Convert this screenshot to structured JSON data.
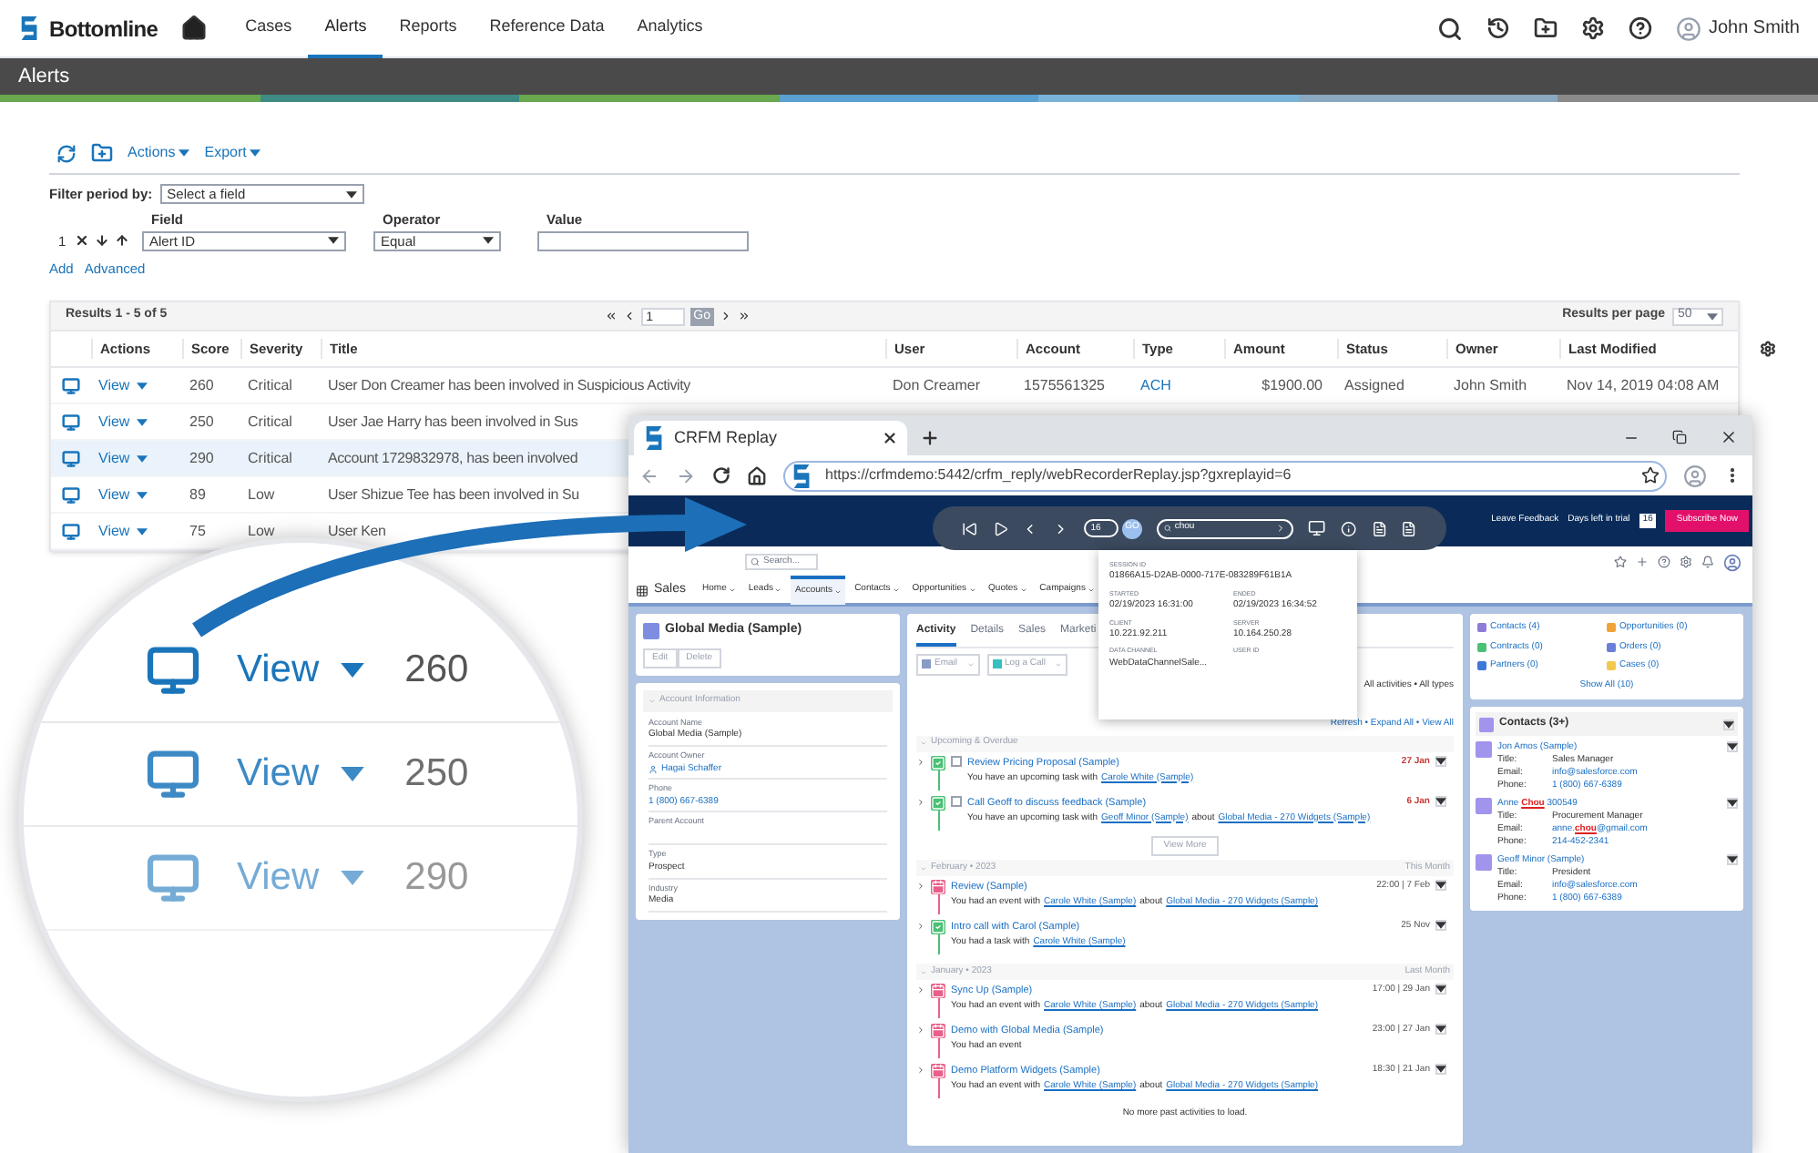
{
  "app_bar": {
    "logo": "Bottomline",
    "nav": [
      {
        "label": "Cases",
        "selected": false
      },
      {
        "label": "Alerts",
        "selected": true
      },
      {
        "label": "Reports",
        "selected": false
      },
      {
        "label": "Reference Data",
        "selected": false
      },
      {
        "label": "Analytics",
        "selected": false
      }
    ],
    "user": "John Smith"
  },
  "page_title": "Alerts",
  "toolbar": {
    "menus": [
      "Actions",
      "Export"
    ]
  },
  "filter": {
    "period_label": "Filter period by:",
    "period_placeholder": "Select a field",
    "row_number": "1",
    "field_label": "Field",
    "field_value": "Alert ID",
    "operator_label": "Operator",
    "operator_value": "Equal",
    "value_label": "Value",
    "links": [
      "Add",
      "Advanced"
    ]
  },
  "results": {
    "summary": "Results 1 - 5 of 5",
    "page": "1",
    "go": "Go",
    "per_page_label": "Results per page",
    "per_page": "50",
    "columns": [
      "Actions",
      "Score",
      "Severity",
      "Title",
      "User",
      "Account",
      "Type",
      "Amount",
      "Status",
      "Owner",
      "Last Modified"
    ],
    "rows": [
      {
        "selected": false,
        "cells": [
          "View",
          "260",
          "Critical",
          "User Don Creamer has been involved in Suspicious Activity",
          "Don Creamer",
          "1575561325",
          "ACH",
          "$1900.00",
          "Assigned",
          "John Smith",
          "Nov 14, 2019 04:08 AM"
        ]
      },
      {
        "selected": false,
        "cells": [
          "View",
          "250",
          "Critical",
          "User Jae Harry has been involved in Sus"
        ]
      },
      {
        "selected": true,
        "cells": [
          "View",
          "290",
          "Critical",
          "Account 1729832978, has been involved"
        ]
      },
      {
        "selected": false,
        "cells": [
          "View",
          "89",
          "Low",
          "User Shizue Tee has been involved in Su"
        ]
      },
      {
        "selected": false,
        "cells": [
          "View",
          "75",
          "Low",
          "User Ken"
        ]
      }
    ]
  },
  "lens": {
    "rows": [
      {
        "action": "View",
        "score": "260"
      },
      {
        "action": "View",
        "score": "250"
      },
      {
        "action": "View",
        "score": "290"
      }
    ]
  },
  "browser": {
    "tab_title": "CRFM Replay",
    "url": "https://crfmdemo:5442/crfm_reply/webRecorderReplay.jsp?gxreplayid=6"
  },
  "replay": {
    "step": "16",
    "go": "GO",
    "search": "chou",
    "header_links": [
      "Leave Feedback",
      "Days left in trial"
    ],
    "trial_days": "16",
    "subscribe": "Subscribe Now",
    "session": [
      {
        "label": "SESSION ID",
        "value": "01866A15-D2AB-0000-717E-083289F61B1A"
      },
      {
        "label": "STARTED",
        "value": "02/19/2023 16:31:00"
      },
      {
        "label": "ENDED",
        "value": "02/19/2023 16:34:52"
      },
      {
        "label": "CLIENT",
        "value": "10.221.92.211"
      },
      {
        "label": "SERVER",
        "value": "10.164.250.28"
      },
      {
        "label": "DATA CHANNEL",
        "value": "WebDataChannelSale..."
      },
      {
        "label": "USER ID"
      }
    ]
  },
  "crm": {
    "search_placeholder": "Search...",
    "app": "Sales",
    "nav": [
      {
        "label": "Home",
        "selected": false
      },
      {
        "label": "Leads",
        "selected": false
      },
      {
        "label": "Accounts",
        "selected": true
      },
      {
        "label": "Contacts",
        "selected": false
      },
      {
        "label": "Opportunities",
        "selected": false
      },
      {
        "label": "Quotes",
        "selected": false
      },
      {
        "label": "Campaigns",
        "selected": false
      }
    ],
    "record": {
      "title": "Global Media (Sample)",
      "buttons": [
        "Edit",
        "Delete"
      ],
      "section": "Account Information",
      "fields": [
        {
          "label": "Account Name",
          "value": "Global Media (Sample)",
          "kind": "text"
        },
        {
          "label": "Account Owner",
          "value": "Hagai Schaffer",
          "kind": "user"
        },
        {
          "label": "Phone",
          "value": "1 (800) 667-6389",
          "kind": "link"
        },
        {
          "label": "Parent Account"
        },
        {
          "label": "Type",
          "value": "Prospect",
          "kind": "text"
        },
        {
          "label": "Industry",
          "value": "Media",
          "kind": "text"
        }
      ]
    },
    "activity": {
      "tabs": [
        {
          "label": "Activity",
          "selected": true
        },
        {
          "label": "Details",
          "selected": false
        },
        {
          "label": "Sales",
          "selected": false
        },
        {
          "label": "Marketi",
          "selected": false
        }
      ],
      "actions": [
        "Email",
        "Log a Call"
      ],
      "filter": "All activities • All types",
      "links": "Refresh • Expand All • View All",
      "groups": [
        {
          "title": "Upcoming & Overdue",
          "more": "View More",
          "items": [
            {
              "kind": "task",
              "checked": false,
              "title": "Review Pricing Proposal (Sample)",
              "parts": [
                {
                  "text": "You have an upcoming task with"
                },
                {
                  "text": "Carole White (Sample)",
                  "link": true
                }
              ],
              "date": "27 Jan",
              "overdue": true
            },
            {
              "kind": "task",
              "checked": false,
              "title": "Call Geoff to discuss feedback (Sample)",
              "parts": [
                {
                  "text": "You have an upcoming task with"
                },
                {
                  "text": "Geoff Minor (Sample)",
                  "link": true
                },
                {
                  "text": "about"
                },
                {
                  "text": "Global Media - 270 Widgets (Sample)",
                  "link": true
                }
              ],
              "date": "6 Jan",
              "overdue": true
            }
          ]
        },
        {
          "title": "February • 2023",
          "period": "This Month",
          "items": [
            {
              "kind": "event",
              "title": "Review (Sample)",
              "parts": [
                {
                  "text": "You had an event with"
                },
                {
                  "text": "Carole White (Sample)",
                  "link": true
                },
                {
                  "text": "about"
                },
                {
                  "text": "Global Media - 270 Widgets (Sample)",
                  "link": true
                }
              ],
              "date": "22:00 | 7 Feb",
              "overdue": false
            },
            {
              "kind": "task",
              "title": "Intro call with Carol (Sample)",
              "parts": [
                {
                  "text": "You had a task with"
                },
                {
                  "text": "Carole White (Sample)",
                  "link": true
                }
              ],
              "date": "25 Nov",
              "overdue": false
            }
          ]
        },
        {
          "title": "January • 2023",
          "period": "Last Month",
          "items": [
            {
              "kind": "event",
              "title": "Sync Up (Sample)",
              "parts": [
                {
                  "text": "You had an event with"
                },
                {
                  "text": "Carole White (Sample)",
                  "link": true
                },
                {
                  "text": "about"
                },
                {
                  "text": "Global Media - 270 Widgets (Sample)",
                  "link": true
                }
              ],
              "date": "17:00 | 29 Jan",
              "overdue": false
            },
            {
              "kind": "event",
              "title": "Demo with Global Media (Sample)",
              "parts": [
                {
                  "text": "You had an event"
                }
              ],
              "date": "23:00 | 27 Jan",
              "overdue": false
            },
            {
              "kind": "event",
              "title": "Demo Platform Widgets (Sample)",
              "parts": [
                {
                  "text": "You had an event with"
                },
                {
                  "text": "Carole White (Sample)",
                  "link": true
                },
                {
                  "text": "about"
                },
                {
                  "text": "Global Media - 270 Widgets (Sample)",
                  "link": true
                }
              ],
              "date": "18:30 | 21 Jan",
              "overdue": false
            }
          ]
        }
      ],
      "footer": "No more past activities to load."
    },
    "related": [
      {
        "label": "Contacts (4)",
        "color": "#8e7cd6"
      },
      {
        "label": "Opportunities (0)",
        "color": "#f0a33a"
      },
      {
        "label": "Contracts (0)",
        "color": "#4bc076"
      },
      {
        "label": "Orders (0)",
        "color": "#6a7fd8"
      },
      {
        "label": "Partners (0)",
        "color": "#3c78d8"
      },
      {
        "label": "Cases (0)",
        "color": "#f2c94c"
      }
    ],
    "show_all": "Show All (10)",
    "contacts": {
      "title": "Contacts (3+)",
      "people": [
        {
          "name": "Jon Amos (Sample)",
          "fields": [
            {
              "label": "Title:",
              "value": "Sales Manager",
              "link": false
            },
            {
              "label": "Email:",
              "value": "info@salesforce.com",
              "link": true
            },
            {
              "label": "Phone:",
              "value": "1 (800) 667-6389",
              "link": true
            }
          ]
        },
        {
          "name": "Anne **Chou** 300549",
          "fields": [
            {
              "label": "Title:",
              "value": "Procurement Manager",
              "link": false
            },
            {
              "label": "Email:",
              "value": "anne.**chou**@gmail.com",
              "link": true
            },
            {
              "label": "Phone:",
              "value": "214-452-2341",
              "link": true
            }
          ]
        },
        {
          "name": "Geoff Minor (Sample)",
          "fields": [
            {
              "label": "Title:",
              "value": "President",
              "link": false
            },
            {
              "label": "Email:",
              "value": "info@salesforce.com",
              "link": true
            },
            {
              "label": "Phone:",
              "value": "1 (800) 667-6389",
              "link": true
            }
          ]
        }
      ]
    }
  }
}
